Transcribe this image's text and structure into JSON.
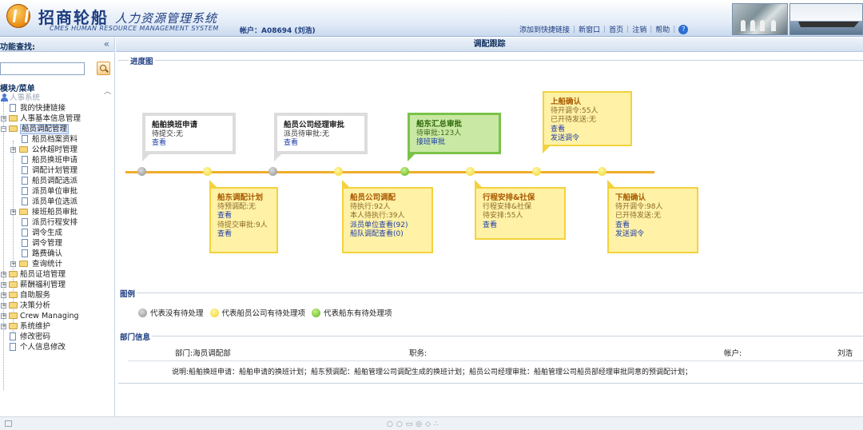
{
  "header": {
    "brand_cn": "招商轮船",
    "system_cn": "人力资源管理系统",
    "brand_en": "CMES HUMAN RESOURCE MANAGEMENT SYSTEM",
    "account": "帐户：A08694 (刘浩)",
    "links": [
      "添加到快捷链接",
      "新窗口",
      "首页",
      "注销",
      "帮助"
    ]
  },
  "sidebar": {
    "title": "功能查找:",
    "search_placeholder": "",
    "menu_title": "模块/菜单",
    "tree": {
      "root": "人事系统",
      "i1": "我的快捷链接",
      "i2": "人事基本信息管理",
      "i3": "船员调配管理",
      "i4": "船员档案资料",
      "i5": "公休超时管理",
      "i6": "船员换班申请",
      "i7": "调配计划管理",
      "i8": "船员调配选派",
      "i9": "派员单位审批",
      "i10": "派员单位选派",
      "i11": "接班船员审批",
      "i12": "派员行程安排",
      "i13": "调令生成",
      "i14": "调令管理",
      "i15": "路费确认",
      "i16": "查询统计",
      "i17": "船员证培管理",
      "i18": "薪酬福利管理",
      "i19": "自助服务",
      "i20": "决策分析",
      "i21": "Crew Managing",
      "i22": "系统维护",
      "i23": "修改密码",
      "i24": "个人信息修改"
    }
  },
  "main": {
    "title": "调配跟踪",
    "progress_title": "进度图",
    "cards": {
      "c1": {
        "title": "船舶换班申请",
        "l1": "待提交:无",
        "link": "查看"
      },
      "c2": {
        "title": "船员公司经理审批",
        "l1": "派员待审批:无",
        "link": "查看"
      },
      "c3": {
        "title": "船东汇总审批",
        "l1": "待审批:123人",
        "link": "接班审批"
      },
      "c4": {
        "title": "上船确认",
        "l1": "待开调令:55人",
        "l2": "已开待发送:无",
        "link1": "查看",
        "link2": "发送调令"
      },
      "c5": {
        "title": "船东调配计划",
        "l1": "待预调配:无",
        "link1": "查看",
        "l2": "待提交审批:9人",
        "link2": "查看"
      },
      "c6": {
        "title": "船员公司调配",
        "l1": "待执行:92人",
        "l2": "本人待执行:39人",
        "link1": "派员单位查看(92)",
        "link2": "船队调配查看(0)"
      },
      "c7": {
        "title": "行程安排&社保",
        "l1": "行程安排&社保",
        "l2": "待安排:55人",
        "link": "查看"
      },
      "c8": {
        "title": "下船确认",
        "l1": "待开调令:98人",
        "l2": "已开待发送:无",
        "link1": "查看",
        "link2": "发送调令"
      }
    },
    "legend_title": "图例",
    "legend": [
      "代表没有待处理",
      "代表船员公司有待处理项",
      "代表船东有待处理项"
    ],
    "dept_title": "部门信息",
    "dept": {
      "dept_label": "部门:海员调配部",
      "position_label": "职务:",
      "account_label": "帐户:",
      "account_value": "刘浩",
      "note": "说明:船舶换班申请：船舶申请的换班计划；船东预调配：船舶管理公司调配生成的换班计划；船员公司经理审批：船舶管理公司船员部经理审批同意的预调配计划；"
    }
  },
  "colors": {
    "gray": "#dcdcdc",
    "yellow": "#f3d23d",
    "green": "#7ac34a",
    "line": "#f0ac2a"
  }
}
